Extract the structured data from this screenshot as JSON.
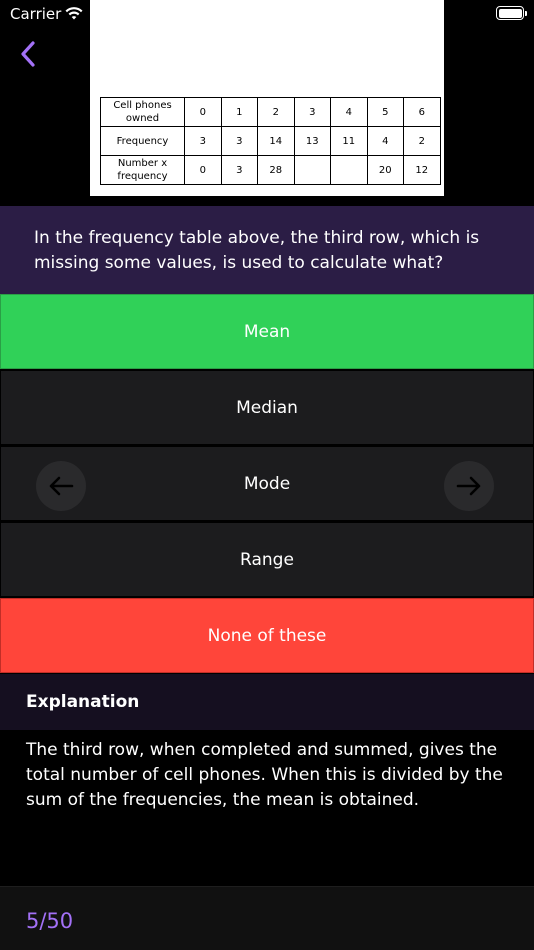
{
  "status_bar": {
    "carrier": "Carrier"
  },
  "figure_table": {
    "rows": [
      {
        "label": "Cell phones owned",
        "cells": [
          "0",
          "1",
          "2",
          "3",
          "4",
          "5",
          "6"
        ]
      },
      {
        "label": "Frequency",
        "cells": [
          "3",
          "3",
          "14",
          "13",
          "11",
          "4",
          "2"
        ]
      },
      {
        "label": "Number x frequency",
        "cells": [
          "0",
          "3",
          "28",
          "",
          "",
          "20",
          "12"
        ]
      }
    ]
  },
  "question": {
    "text": "In the frequency table above, the third row, which is missing some values, is used to calculate what?"
  },
  "answers": [
    {
      "label": "Mean",
      "state": "correct"
    },
    {
      "label": "Median",
      "state": "neutral"
    },
    {
      "label": "Mode",
      "state": "neutral"
    },
    {
      "label": "Range",
      "state": "neutral"
    },
    {
      "label": "None of these",
      "state": "wrong"
    }
  ],
  "explanation": {
    "title": "Explanation",
    "body": "The third row, when completed and summed, gives the total number of cell phones. When this is divided by the sum of the frequencies, the mean is obtained."
  },
  "progress": {
    "text": "5/50"
  },
  "colors": {
    "accent": "#a371f7",
    "correct": "#30d158",
    "wrong": "#ff453a",
    "question_bg": "#2b1d45"
  },
  "icons": {
    "back": "chevron-left-icon",
    "prev": "arrow-left-icon",
    "next": "arrow-right-icon",
    "wifi": "wifi-icon",
    "battery": "battery-icon"
  }
}
